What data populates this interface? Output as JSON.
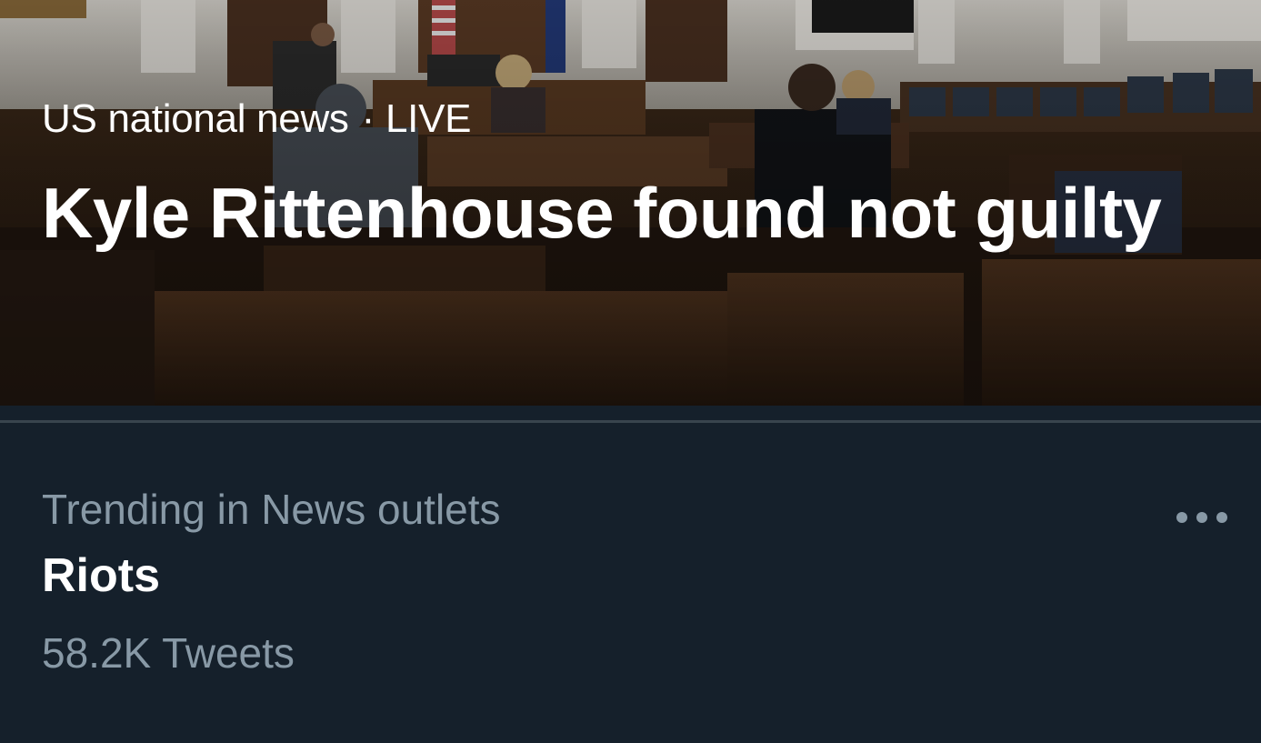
{
  "hero": {
    "category": "US national news",
    "separator": "·",
    "status": "LIVE",
    "title": "Kyle Rittenhouse found not guilty",
    "image_icon": "courtroom-photo"
  },
  "trend": {
    "context": "Trending in News outlets",
    "name": "Riots",
    "count": "58.2K Tweets",
    "more_icon": "more-horizontal-icon"
  },
  "colors": {
    "background": "#15202b",
    "secondary_text": "#8899a6",
    "primary_text": "#ffffff",
    "divider": "#38444d"
  }
}
